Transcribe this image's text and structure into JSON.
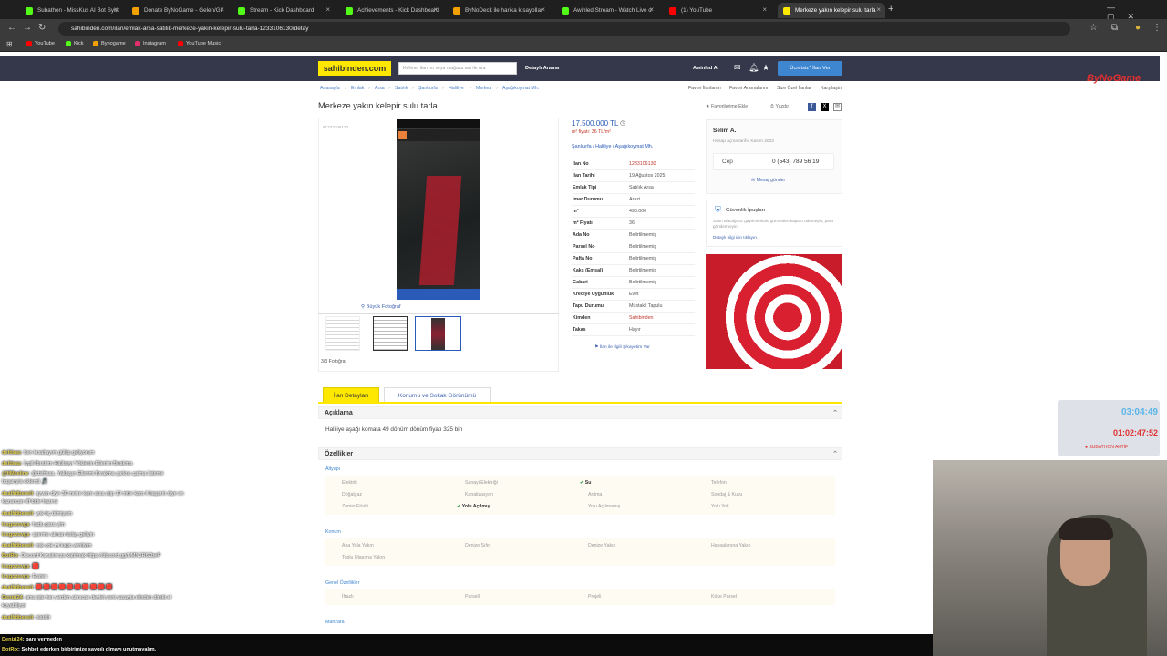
{
  "browser": {
    "tabs": [
      {
        "title": "Subathon - MissKus AI Bot Syst",
        "color": "#53fc18"
      },
      {
        "title": "Donate ByNoGame - Gelen/Gi",
        "color": "#f2a100"
      },
      {
        "title": "Stream - Kick Dashboard",
        "color": "#53fc18"
      },
      {
        "title": "Achievements - Kick Dashboard",
        "color": "#53fc18"
      },
      {
        "title": "ByNoDeck ile harika kısayollar",
        "color": "#f2a100"
      },
      {
        "title": "Awinled Stream - Watch Live o",
        "color": "#53fc18"
      },
      {
        "title": "(1) YouTube",
        "color": "#ff0000"
      },
      {
        "title": "Merkeze yakın kelepir sulu tarla",
        "color": "#ffe800"
      }
    ],
    "url": "sahibinden.com/ilan/emlak-arsa-satilik-merkeze-yakin-kelepir-sulu-tarla-1233106130/detay",
    "bookmarks": [
      {
        "label": "YouTube",
        "color": "#ff0000"
      },
      {
        "label": "Kick",
        "color": "#53fc18"
      },
      {
        "label": "Bynogame",
        "color": "#f2a100"
      },
      {
        "label": "Instagram",
        "color": "#e1306c"
      },
      {
        "label": "YouTube Music",
        "color": "#ff0000"
      }
    ]
  },
  "header": {
    "logo": "sahibinden.com",
    "search_placeholder": "Kelime, ilan no veya mağaza adı ile ara",
    "detailed_search": "Detaylı Arama",
    "user": "Awinled A.",
    "post_button": "Ücretsiz* İlan Ver"
  },
  "breadcrumbs": [
    "Anasayfa",
    "Emlak",
    "Arsa",
    "Satılık",
    "Şanlıurfa",
    "Haliliye",
    "Merkez",
    "Aşağıkoymat Mh."
  ],
  "top_links": [
    "Favori İlanlarım",
    "Favori Aramalarım",
    "Size Özel İlanlar",
    "Karşılaştır"
  ],
  "listing": {
    "title": "Merkeze yakın kelepir sulu tarla",
    "favorite": "Favorilerime Ekle",
    "print": "Yazdır",
    "image_id": "#1233106130",
    "big_photo": "Büyük Fotoğraf",
    "photo_count": "3/3 Fotoğraf",
    "price": "17.500.000 TL",
    "m2_price": "m² fiyatı: 36 TL/m²",
    "location": [
      "Şanlıurfa",
      "Haliliye",
      "Aşağıkoymat Mh."
    ],
    "details": [
      {
        "k": "İlan No",
        "v": "1233106130"
      },
      {
        "k": "İlan Tarihi",
        "v": "19 Ağustos 2025"
      },
      {
        "k": "Emlak Tipi",
        "v": "Satılık Arsa"
      },
      {
        "k": "İmar Durumu",
        "v": "Arazi"
      },
      {
        "k": "m²",
        "v": "490.000"
      },
      {
        "k": "m² Fiyatı",
        "v": "36"
      },
      {
        "k": "Ada No",
        "v": "Belirtilmemiş"
      },
      {
        "k": "Parsel No",
        "v": "Belirtilmemiş"
      },
      {
        "k": "Pafta No",
        "v": "Belirtilmemiş"
      },
      {
        "k": "Kaks (Emsal)",
        "v": "Belirtilmemiş"
      },
      {
        "k": "Gabari",
        "v": "Belirtilmemiş"
      },
      {
        "k": "Krediye Uygunluk",
        "v": "Evet"
      },
      {
        "k": "Tapu Durumu",
        "v": "Müstakil Tapulu"
      },
      {
        "k": "Kimden",
        "v": "Sahibinden"
      },
      {
        "k": "Takas",
        "v": "Hayır"
      }
    ],
    "complaint": "İlan ile İlgili Şikayetim Var"
  },
  "seller": {
    "name": "Selim A.",
    "since": "Hesap açma tarihi: Kasım 2023",
    "phone_label": "Cep",
    "phone": "0 (543) 789 56 19",
    "message": "Mesaj gönder",
    "tips_title": "Güvenlik İpuçları",
    "tips_text": "Satın alacağınız gayrimenkulü görmeden kaparo ödemeyin, para göndermeyin.",
    "tips_more": "Detaylı bilgi için tıklayın."
  },
  "tabs": [
    "İlan Detayları",
    "Konumu ve Sokak Görünümü"
  ],
  "description": {
    "title": "Açıklama",
    "text": "Haliliye aşağı komata 49 dönüm dönüm fiyatı 325 bin"
  },
  "features": {
    "title": "Özellikler",
    "groups": [
      {
        "name": "Altyapı",
        "items": [
          {
            "t": "Elektrik",
            "on": false
          },
          {
            "t": "Sanayi Elektriği",
            "on": false
          },
          {
            "t": "Su",
            "on": true
          },
          {
            "t": "Telefon",
            "on": false
          },
          {
            "t": "Doğalgaz",
            "on": false
          },
          {
            "t": "Kanalizasyon",
            "on": false
          },
          {
            "t": "Arıtma",
            "on": false
          },
          {
            "t": "Sondaj & Kuyu",
            "on": false
          },
          {
            "t": "Zemin Etüdü",
            "on": false
          },
          {
            "t": "Yolu Açılmış",
            "on": true
          },
          {
            "t": "Yolu Açılmamış",
            "on": false
          },
          {
            "t": "Yolu Yok",
            "on": false
          }
        ]
      },
      {
        "name": "Konum",
        "items": [
          {
            "t": "Ana Yola Yakın",
            "on": false
          },
          {
            "t": "Denize Sıfır",
            "on": false
          },
          {
            "t": "Denize Yakın",
            "on": false
          },
          {
            "t": "Havaalanına Yakın",
            "on": false
          },
          {
            "t": "Toplu Ulaşıma Yakın",
            "on": false
          }
        ]
      },
      {
        "name": "Genel Özellikler",
        "items": [
          {
            "t": "İfrazlı",
            "on": false
          },
          {
            "t": "Parselli",
            "on": false
          },
          {
            "t": "Projeli",
            "on": false
          },
          {
            "t": "Köşe Parsel",
            "on": false
          }
        ]
      },
      {
        "name": "Manzara",
        "items": []
      }
    ]
  },
  "overlay": {
    "brand": "ByNoGame",
    "timer1": "03:04:49",
    "timer2": "01:02:47:52",
    "subathon": "SUBATHON AKTİF",
    "chat": [
      {
        "u": "dsfdsas",
        "m": "ben kısaltayım gülüp geliyorum"
      },
      {
        "u": "dsfdsas",
        "m": "İçgili İbrahim Halilseyi Yöklenin Ellerimi Bırakma"
      },
      {
        "u": "@fiMeeline",
        "m": "@dsfdsas, Yaklaşın Ellerimi Bırakma şarkısı çalma listeme başarıyla eklendi 🎵"
      },
      {
        "u": "dsalfidbeneli",
        "m": "ayvan diye 30 metre kare arsa alıp 10 mtre karo il başarılı diye en kazancan iiff bide hazırız"
      },
      {
        "u": "dsalfidbeneli",
        "m": "yok hç bilmiyom"
      },
      {
        "u": "lcsgozuvgs",
        "m": "hadu para yim"
      },
      {
        "u": "lcsgozuvgs",
        "m": "sperme alınan kolay geliyin"
      },
      {
        "u": "dsalfidbeneli",
        "m": "eşk çok iyi kapo yenliyim"
      },
      {
        "u": "BotRix",
        "m": "Discord Kanalımıza katılmak https://discord.gg/UMN1R6ZbeP"
      },
      {
        "u": "lcsgozuvgs",
        "m": "🟥"
      },
      {
        "u": "lcsgozuvgs",
        "m": "Eraten"
      },
      {
        "u": "dsalfidbeneli",
        "m": "🟥 🟥 🟥 🟥 🟥 🟥 🟥 🟥 🟥 🟥"
      },
      {
        "u": "Denizi24",
        "m": "ama işte her yerden alınıcan devlet yeni yasayla elinden direkt el koyabiliyor"
      },
      {
        "u": "dsalfidbeneli",
        "m": "olabilir"
      },
      {
        "u": "Denizi24",
        "m": "para vermeden"
      },
      {
        "u": "BotRix",
        "m": "Sohbet ederken birbirimize saygılı olmayı unutmayalım."
      }
    ]
  }
}
